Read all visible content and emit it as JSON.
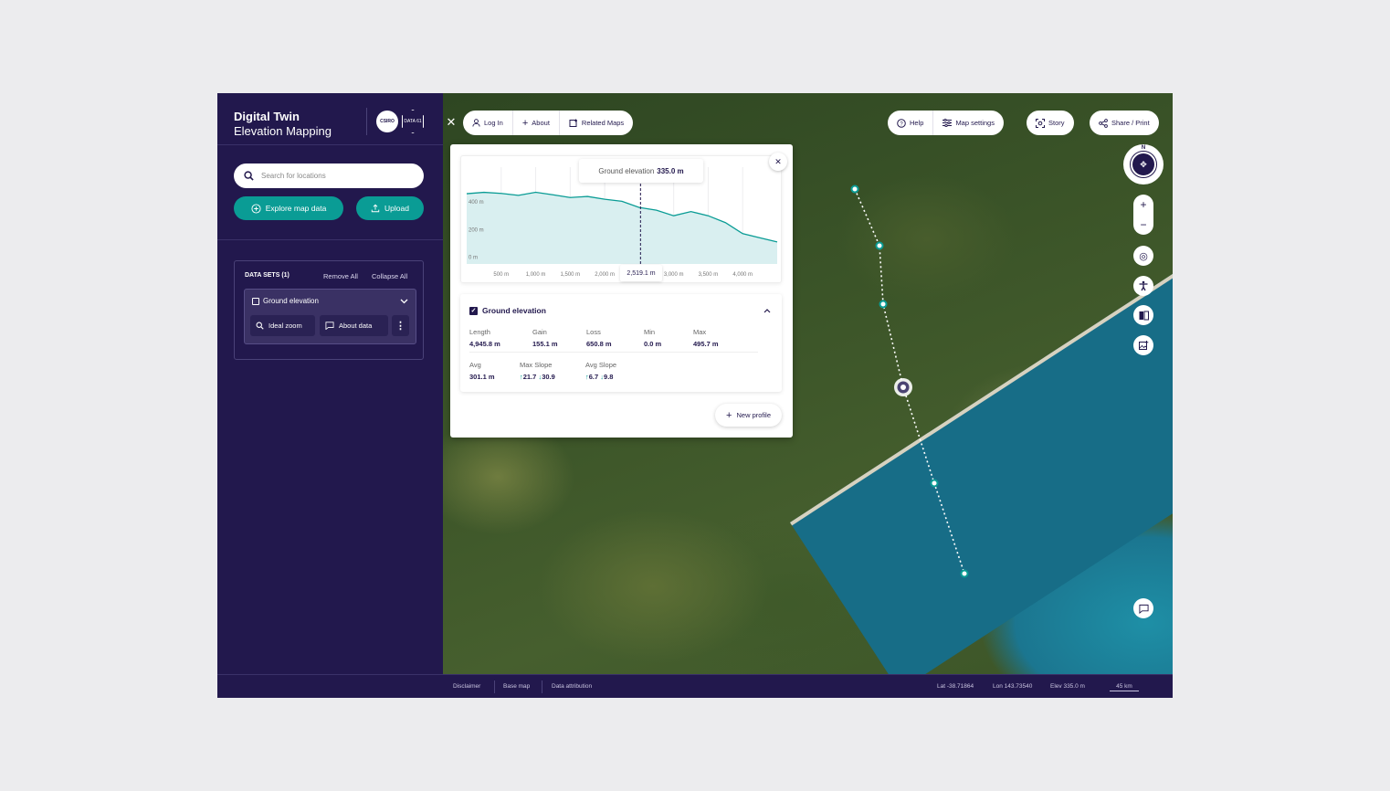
{
  "app": {
    "title_line1": "Digital Twin",
    "title_line2": "Elevation Mapping",
    "logo1": "CSIRO",
    "logo2": "DATA 61"
  },
  "search": {
    "placeholder": "Search for locations"
  },
  "actions": {
    "explore": "Explore map data",
    "upload": "Upload"
  },
  "datasets": {
    "header": "DATA SETS (1)",
    "remove_all": "Remove All",
    "collapse_all": "Collapse All",
    "items": [
      {
        "name": "Ground elevation",
        "ideal_zoom": "Ideal zoom",
        "about": "About data"
      }
    ]
  },
  "topbar": {
    "login": "Log In",
    "about": "About",
    "related": "Related Maps",
    "help": "Help",
    "map_settings": "Map settings",
    "story": "Story",
    "share": "Share / Print"
  },
  "compass": {
    "north": "N"
  },
  "profile": {
    "tooltip_label": "Ground elevation",
    "tooltip_value": "335.0 m",
    "cursor_label": "2,519.1 m",
    "layer": "Ground elevation",
    "stats": {
      "length_l": "Length",
      "length_v": "4,945.8 m",
      "gain_l": "Gain",
      "gain_v": "155.1 m",
      "loss_l": "Loss",
      "loss_v": "650.8 m",
      "min_l": "Min",
      "min_v": "0.0 m",
      "max_l": "Max",
      "max_v": "495.7 m",
      "avg_l": "Avg",
      "avg_v": "301.1 m",
      "maxslope_l": "Max Slope",
      "maxslope_up": "21.7",
      "maxslope_down": "30.9",
      "avgslope_l": "Avg Slope",
      "avgslope_up": "6.7",
      "avgslope_down": "9.8"
    },
    "new_profile": "New profile"
  },
  "chart_data": {
    "type": "area",
    "x": [
      0,
      250,
      500,
      750,
      1000,
      1250,
      1500,
      1750,
      2000,
      2250,
      2500,
      2750,
      3000,
      3250,
      3500,
      3750,
      4000,
      4250,
      4500
    ],
    "y": [
      460,
      470,
      462,
      448,
      470,
      452,
      432,
      440,
      420,
      405,
      360,
      340,
      300,
      330,
      300,
      250,
      170,
      140,
      110
    ],
    "y_ticks": [
      "400 m",
      "200 m",
      "0 m"
    ],
    "y_tick_values": [
      400,
      200,
      0
    ],
    "x_ticks": [
      "500 m",
      "1,000 m",
      "1,500 m",
      "2,000 m",
      "3,000 m",
      "3,500 m",
      "4,000 m"
    ],
    "x_tick_values": [
      500,
      1000,
      1500,
      2000,
      3000,
      3500,
      4000
    ],
    "xlim": [
      0,
      4500
    ],
    "ylim": [
      -50,
      520
    ],
    "cursor_x": 2519.1,
    "grid": true
  },
  "footer": {
    "disclaimer": "Disclaimer",
    "base_map": "Base map",
    "attribution": "Data attribution",
    "lat": "Lat -38.71864",
    "lon": "Lon 143.73540",
    "elev": "Elev 335.0 m",
    "scale": "45 km"
  },
  "colors": {
    "primary": "#22184d",
    "accent": "#0a9c95",
    "chart_fill": "#d9eff0"
  }
}
